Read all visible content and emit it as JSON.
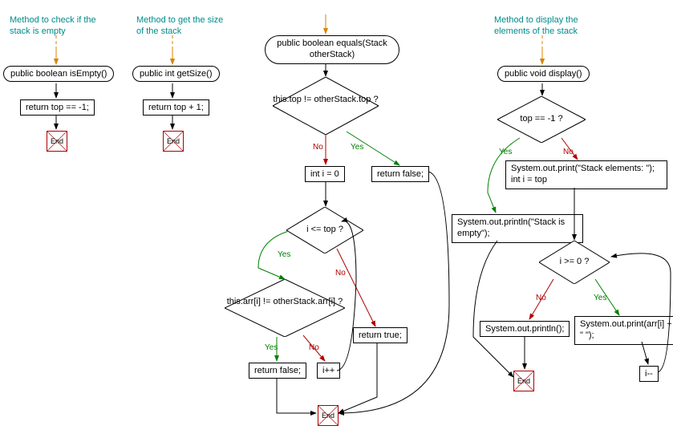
{
  "flowcharts": [
    {
      "name": "isEmpty",
      "comment": "Method to check if the stack is empty",
      "entry_label": "public boolean isEmpty()",
      "steps": [
        "return top == -1;"
      ],
      "terminal": "End"
    },
    {
      "name": "getSize",
      "comment": "Method to get the size of the stack",
      "entry_label": "public int getSize()",
      "steps": [
        "return top + 1;"
      ],
      "terminal": "End"
    },
    {
      "name": "equals",
      "entry_label": "public boolean equals(Stack otherStack)",
      "decision1": "this.top != otherStack.top ?",
      "d1_no": "int i = 0",
      "d1_yes": "return false;",
      "decision2": "i <= top ?",
      "decision3": "this.arr[i] != otherStack.arr[i] ?",
      "d3_yes": "return false;",
      "d3_no": "i++",
      "d2_no": "return true;",
      "terminal": "End",
      "labels": {
        "yes": "Yes",
        "no": "No"
      }
    },
    {
      "name": "display",
      "comment": "Method to display the elements of the stack",
      "entry_label": "public void display()",
      "decision1": "top == -1 ?",
      "d1_yes": "System.out.println(\"Stack is empty\");",
      "d1_no": "System.out.print(\"Stack elements: \");\nint i = top",
      "decision2": "i >= 0 ?",
      "d2_yes": "System.out.print(arr[i] + \" \");",
      "d2_no": "System.out.println();",
      "loop_step": "i--",
      "terminal": "End",
      "labels": {
        "yes": "Yes",
        "no": "No"
      }
    }
  ]
}
